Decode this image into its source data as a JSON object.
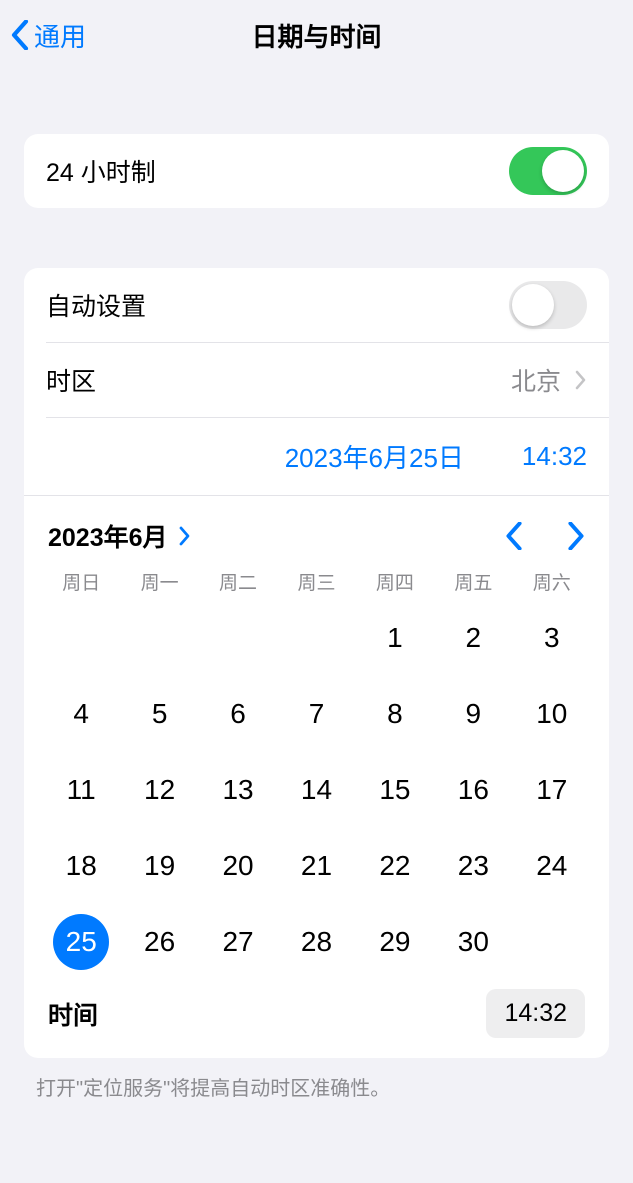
{
  "nav": {
    "back_label": "通用",
    "title": "日期与时间"
  },
  "section1": {
    "time_format_label": "24 小时制",
    "time_format_on": true
  },
  "section2": {
    "auto_set_label": "自动设置",
    "auto_set_on": false,
    "timezone_label": "时区",
    "timezone_value": "北京",
    "selected_date_label": "2023年6月25日",
    "selected_time_label": "14:32"
  },
  "calendar": {
    "month_label": "2023年6月",
    "weekdays": [
      "周日",
      "周一",
      "周二",
      "周三",
      "周四",
      "周五",
      "周六"
    ],
    "leading_blanks": 4,
    "days": [
      1,
      2,
      3,
      4,
      5,
      6,
      7,
      8,
      9,
      10,
      11,
      12,
      13,
      14,
      15,
      16,
      17,
      18,
      19,
      20,
      21,
      22,
      23,
      24,
      25,
      26,
      27,
      28,
      29,
      30
    ],
    "selected_day": 25,
    "time_label": "时间",
    "time_value": "14:32"
  },
  "footer": {
    "hint": "打开\"定位服务\"将提高自动时区准确性。"
  },
  "colors": {
    "accent": "#007aff",
    "switch_on": "#34c759"
  }
}
